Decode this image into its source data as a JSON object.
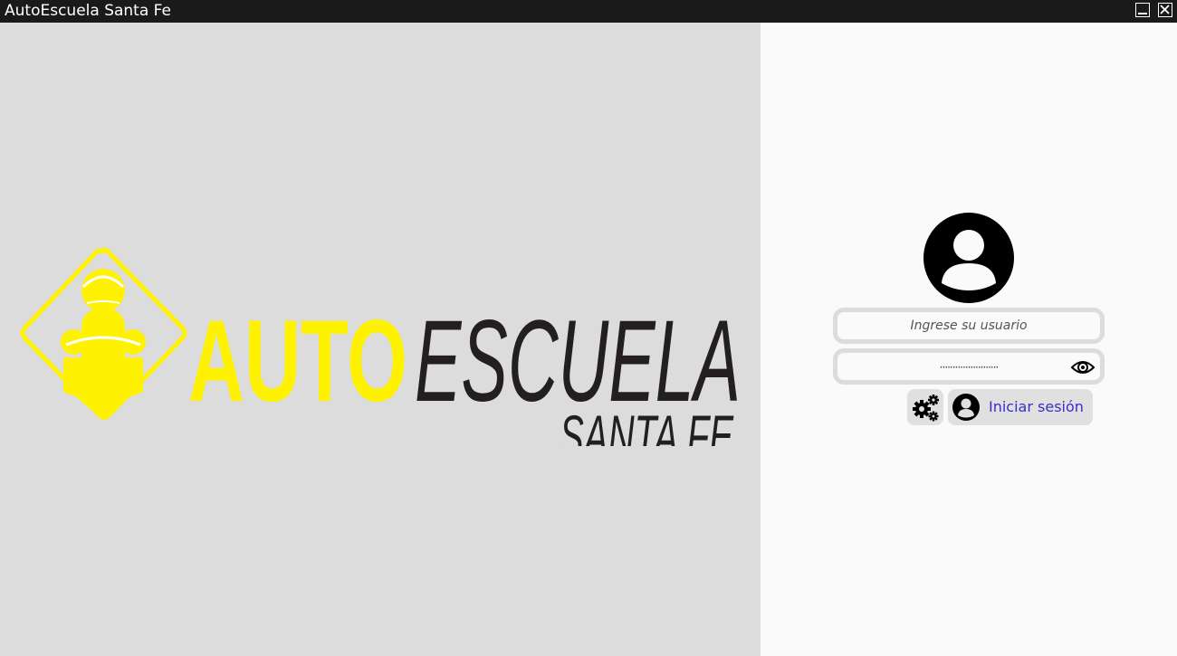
{
  "window": {
    "title": "AutoEscuela Santa Fe",
    "controls": [
      "minimize-icon",
      "close-icon"
    ]
  },
  "branding": {
    "logo_word_1": "AUTO",
    "logo_word_2": "ESCUELA",
    "logo_word_3": "SANTA FE",
    "accent_color": "#fff200",
    "text_color": "#231f20"
  },
  "login": {
    "avatar_icon": "user-avatar-icon",
    "username": {
      "placeholder": "Ingrese su usuario",
      "value": ""
    },
    "password": {
      "masked_value": "·······················",
      "toggle_icon": "eye-icon"
    },
    "settings_icon": "gears-icon",
    "login_button_label": "Iniciar sesión",
    "login_button_icon": "user-icon",
    "login_label_color": "#3a2ec8"
  }
}
